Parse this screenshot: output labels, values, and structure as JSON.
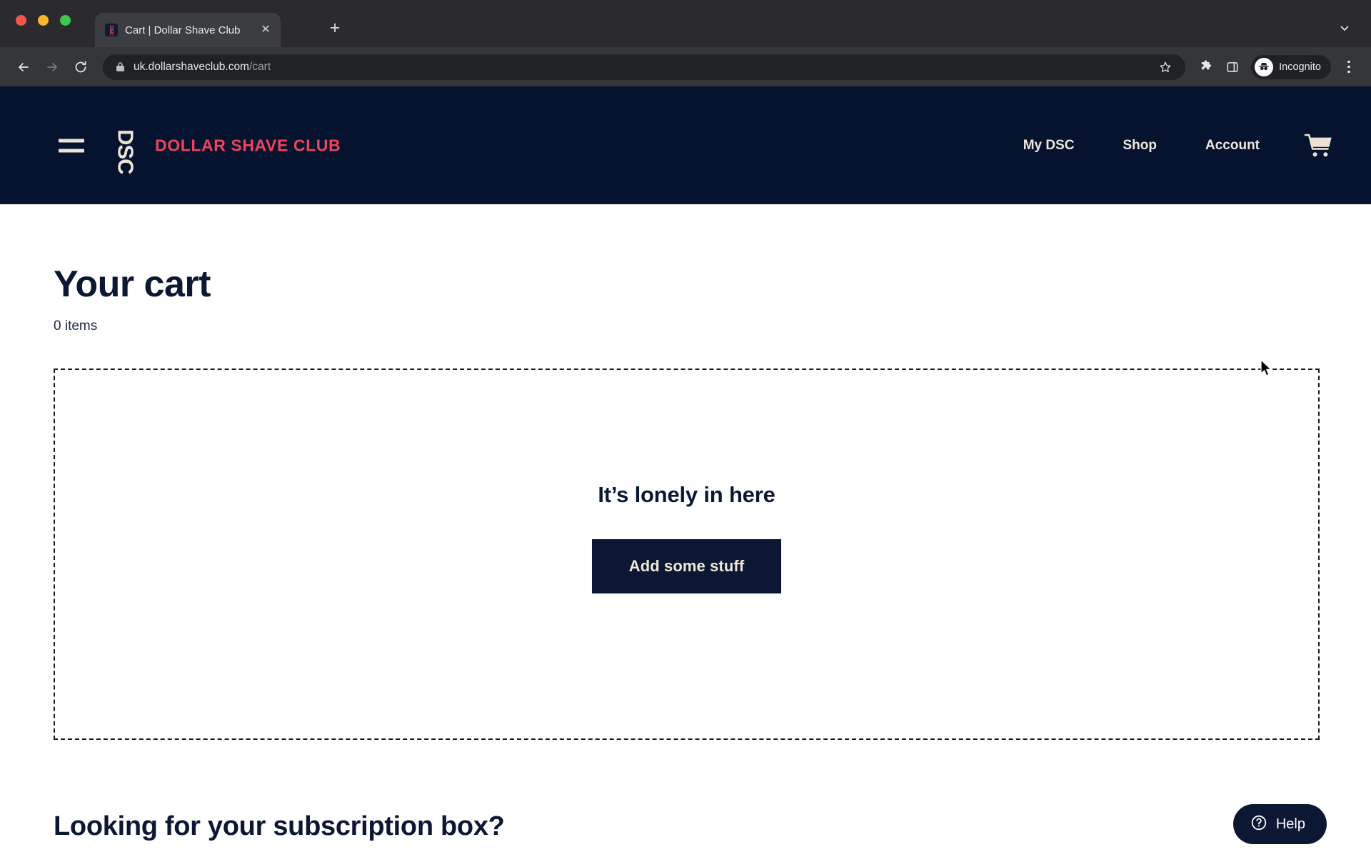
{
  "browser": {
    "tab": {
      "title": "Cart | Dollar Shave Club",
      "favicon_name": "dsc-favicon",
      "favicon_mark": "DSC",
      "close_label": "✕"
    },
    "new_tab_label": "+",
    "toolbar": {
      "back_label": "←",
      "forward_label": "→",
      "reload_label": "↻",
      "url_domain": "uk.dollarshaveclub.com",
      "url_path": "/cart",
      "bookmark_icon": "star-icon",
      "extensions_icon": "puzzle-piece-icon",
      "sidepanel_icon": "side-panel-icon",
      "profile_label": "Incognito",
      "menu_icon": "three-dot-menu-icon"
    }
  },
  "site": {
    "header": {
      "menu_icon": "hamburger-menu-icon",
      "brand_mark": "DSC",
      "brand_word": "DOLLAR SHAVE CLUB",
      "nav": [
        {
          "label": "My DSC"
        },
        {
          "label": "Shop"
        },
        {
          "label": "Account"
        }
      ],
      "cart_icon": "shopping-cart-icon",
      "background_color": "#05132e",
      "brand_color": "#f0435f",
      "cream_color": "#ece3d5"
    },
    "cart": {
      "title": "Your cart",
      "item_count": "0 items",
      "empty_title": "It’s lonely in here",
      "cta_label": "Add some stuff"
    },
    "subscription": {
      "heading": "Looking for your subscription box?"
    },
    "help": {
      "label": "Help",
      "icon": "question-mark-circle-icon"
    }
  }
}
